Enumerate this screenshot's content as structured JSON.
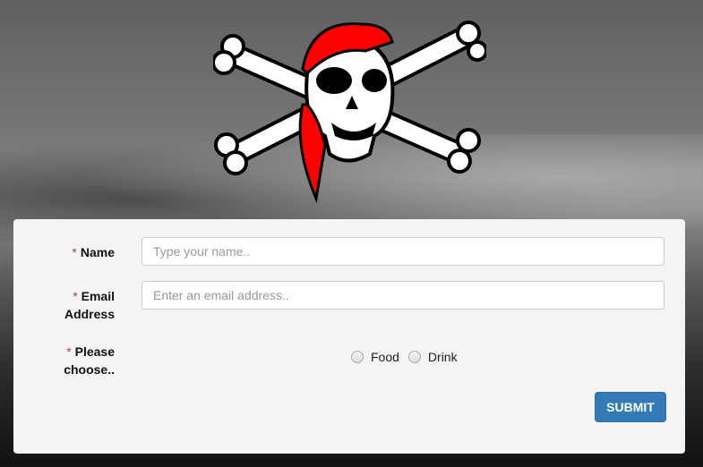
{
  "logo": {
    "icon": "pirate-skull-crossbones-icon",
    "bandana_color": "#ff0000"
  },
  "form": {
    "required_mark": "*",
    "name": {
      "label": "Name",
      "placeholder": "Type your name..",
      "value": ""
    },
    "email": {
      "label_line1": "Email",
      "label_line2": "Address",
      "placeholder": "Enter an email address..",
      "value": ""
    },
    "choose": {
      "label_line1": "Please",
      "label_line2": "choose..",
      "options": [
        "Food",
        "Drink"
      ],
      "selected": null
    },
    "submit_label": "SUBMIT",
    "accent_color": "#337ab7"
  }
}
